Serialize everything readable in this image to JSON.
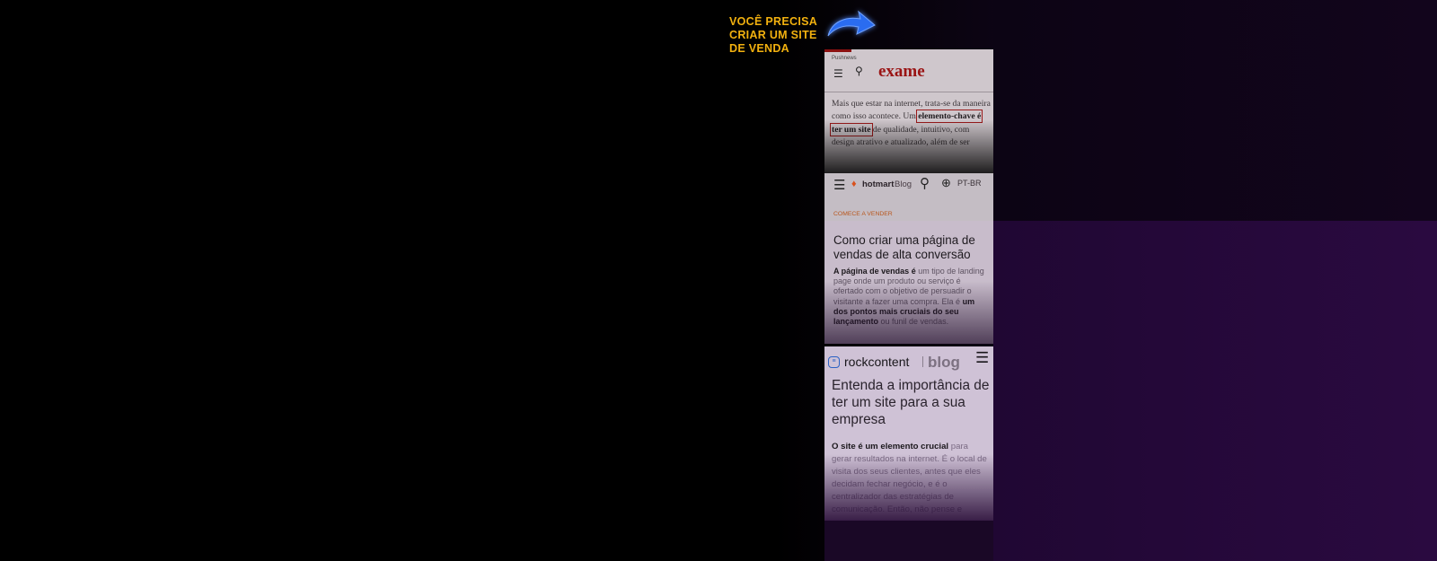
{
  "headline": "VOCÊ PRECISA\nCRIAR UM SITE\nDE VENDA",
  "exame": {
    "source_tag": "Pushnews",
    "logo": "exame",
    "body_before": "Mais que estar na internet, trata-se da maneira como isso acontece. Um ",
    "highlight": "elemento-chave é ter um site",
    "body_after": " de qualidade, intuitivo, com design atrativo e atualizado, além de ser"
  },
  "hotmart": {
    "brand": "hotmart",
    "blog": "Blog",
    "lang": "PT-BR",
    "kicker": "COMECE A VENDER",
    "title": "Como criar uma página de vendas de alta conversão",
    "body_b1": "A página de vendas é",
    "body_t1": " um tipo de landing page onde um produto ou serviço é ofertado com o objetivo de persuadir o visitante a fazer uma compra. Ela é ",
    "body_b2": "um dos pontos mais cruciais do seu lançamento",
    "body_t2": " ou funil de vendas."
  },
  "rockcontent": {
    "brand": "rockcontent",
    "blog": "blog",
    "title": "Entenda a importância de ter um site para a sua empresa",
    "body_b": "O site é um elemento crucial",
    "body_t": " para gerar resultados na internet. É o local de visita dos seus clientes, antes que eles decidam fechar negócio, e é o centralizador das estratégias de comunicação. Então, não pense e"
  },
  "icons": {
    "arrow": "curved-arrow-icon",
    "menu": "hamburger-icon",
    "search": "search-icon",
    "globe": "globe-icon",
    "flame": "flame-icon"
  },
  "colors": {
    "headline": "#f2b10f",
    "arrow": "#2a6cf0",
    "exame_red": "#9a1414",
    "hotmart_orange": "#d8511d",
    "rock_blue": "#2c62c4"
  }
}
